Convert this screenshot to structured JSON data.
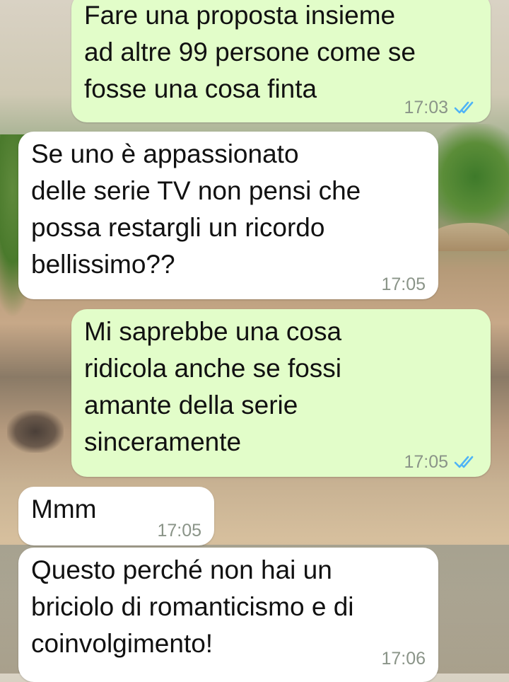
{
  "messages": [
    {
      "direction": "outgoing",
      "text": "Fare una proposta insieme\nad altre 99 persone come se\nfosse una cosa finta",
      "time": "17:03",
      "status": "read-double-check-icon"
    },
    {
      "direction": "incoming",
      "text": "Se uno è appassionato\ndelle serie TV non pensi che\npossa restargli un ricordo\nbellissimo??",
      "time": "17:05"
    },
    {
      "direction": "outgoing",
      "text": "Mi saprebbe una cosa\nridicola anche se fossi\namante della serie\nsinceramente",
      "time": "17:05",
      "status": "read-double-check-icon"
    },
    {
      "direction": "incoming",
      "text": "Mmm",
      "time": "17:05"
    },
    {
      "direction": "incoming",
      "text": "Questo perché non hai un\nbriciolo di romanticismo e di\ncoinvolgimento!",
      "time": "17:06"
    }
  ],
  "colors": {
    "outgoing_bubble": "#e2fdc9",
    "incoming_bubble": "#ffffff",
    "read_ticks": "#4fb3f6",
    "timestamp": "#8a9488"
  }
}
